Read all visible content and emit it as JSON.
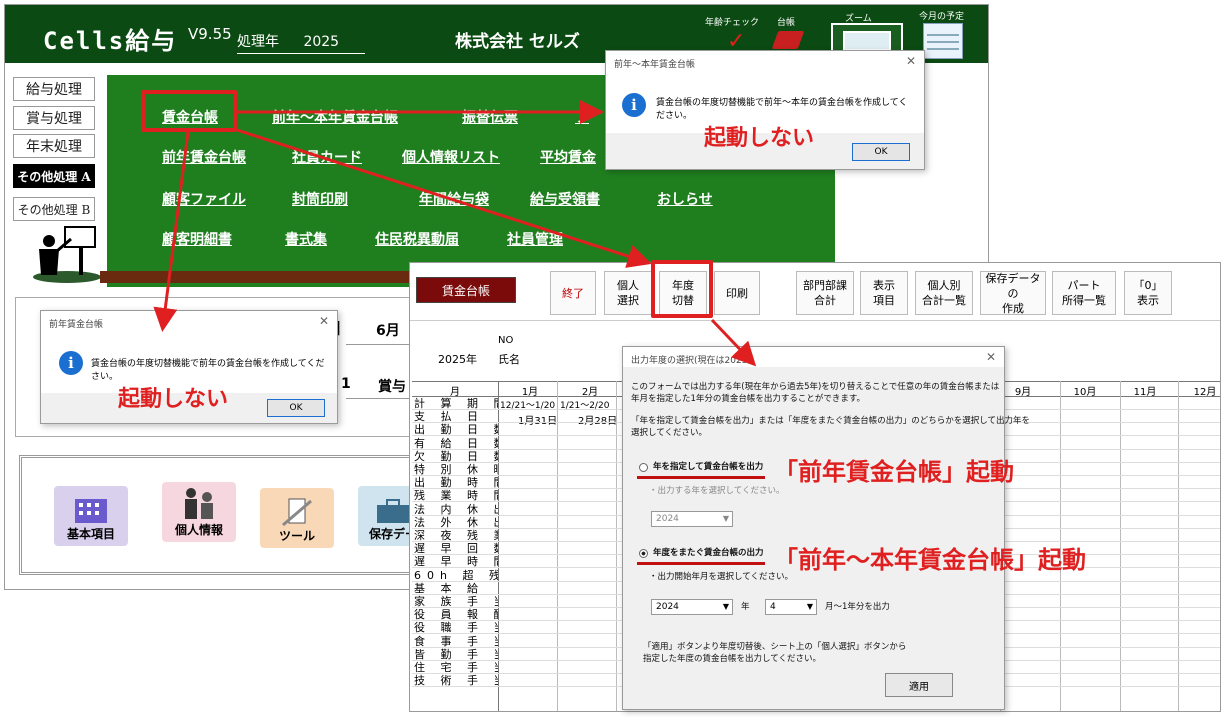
{
  "main_window": {
    "app_title": "Cells給与",
    "version": "V9.55",
    "year_label": "処理年",
    "year_value": "2025",
    "company": "株式会社 セルズ",
    "toolbar": {
      "age_check": "年齢チェック",
      "ledger": "台帳",
      "zoom": "ズーム",
      "schedule": "今月の予定"
    },
    "side_menu": [
      "給与処理",
      "賞与処理",
      "年末処理",
      "その他処理 A",
      "その他処理 B"
    ],
    "menu_links": {
      "wage_ledger": "賃金台帳",
      "prev_to_cur_ledger": "前年～本年賃金台帳",
      "transfer_slip": "振替伝票",
      "partial_f": "フ",
      "prev_ledger": "前年賃金台帳",
      "employee_card": "社員カード",
      "personal_list": "個人情報リスト",
      "avg_wage": "平均賃金",
      "customer_file": "顧客ファイル",
      "envelope_print": "封筒印刷",
      "annual_envelope": "年間給与袋",
      "receipt": "給与受領書",
      "notice": "おしらせ",
      "customer_detail": "顧客明細書",
      "forms": "書式集",
      "resident_tax": "住民税異動届",
      "data_mgmt": "社員管理"
    },
    "lower_table": {
      "head_june": "6月",
      "head_bonus": "賞与",
      "num": "1"
    },
    "tiles": [
      "基本項目",
      "個人情報",
      "ツール",
      "保存デー"
    ]
  },
  "dialog_top": {
    "title": "前年～本年賃金台帳",
    "message": "賃金台帳の年度切替機能で前年～本年の賃金台帳を作成してください。",
    "ok": "OK",
    "note": "起動しない"
  },
  "dialog_left": {
    "title": "前年賃金台帳",
    "message": "賃金台帳の年度切替機能で前年の賃金台帳を作成してください。",
    "ok": "OK",
    "note": "起動しない"
  },
  "sheet": {
    "title_btn": "賃金台帳",
    "buttons": {
      "end": "終了",
      "select_person": "個人\n選択",
      "year_switch": "年度\n切替",
      "print": "印刷",
      "dept_total": "部門部課\n合計",
      "display_items": "表示\n項目",
      "person_total": "個人別\n合計一覧",
      "saved_data": "保存データの\n作成",
      "part_income": "パート\n所得一覧",
      "zero_display": "「0」\n表示"
    },
    "no_label": "NO",
    "year_text": "2025年",
    "name_label": "氏名",
    "month_col": "月",
    "months": [
      "1月",
      "2月",
      "9月",
      "10月",
      "11月",
      "12月"
    ],
    "period_1": "12/21～1/20",
    "period_2": "1/21～2/20",
    "pay_1": "1月31日",
    "pay_2": "2月28日",
    "rows": [
      "計 算 期 間",
      "支 払 日",
      "出 勤 日 数",
      "有 給 日 数",
      "欠 勤 日 数",
      "特 別 休 暇",
      "出 勤 時 間",
      "残 業 時 間",
      "法 内 休 出",
      "法 外 休 出",
      "深 夜 残 業",
      "遅 早 回 数",
      "遅 早 時 間",
      "60h 超 残 業",
      "基 本 給",
      "家 族 手 当",
      "役 員 報 酬",
      "役 職 手 当",
      "食 事 手 当",
      "皆 勤 手 当",
      "住 宅 手 当",
      "技 術 手 当"
    ]
  },
  "year_dialog": {
    "title": "出力年度の選択(現在は2025",
    "desc_1": "このフォームでは出力する年(現在年から過去5年)を切り替えることで任意の年の賃金台帳または",
    "desc_2": "年月を指定した1年分の賃金台帳を出力することができます。",
    "desc_3": "「年を指定して賃金台帳を出力」または「年度をまたぐ賃金台帳の出力」のどちらかを選択して出力年を",
    "desc_4": "選択してください。",
    "option_1": "年を指定して賃金台帳を出力",
    "option_1_sub": "・出力する年を選択してください。",
    "option_1_year": "2024",
    "option_2": "年度をまたぐ賃金台帳の出力",
    "option_2_sub": "・出力開始年月を選択してください。",
    "start_year": "2024",
    "year_unit": "年",
    "start_month": "4",
    "month_suffix": "月～1年分を出力",
    "foot_1": "「適用」ボタンより年度切替後、シート上の「個人選択」ボタンから",
    "foot_2": "指定した年度の賃金台帳を出力してください。",
    "apply": "適用"
  },
  "annotations": {
    "prev_ledger_launch": "「前年賃金台帳」起動",
    "prev_to_cur_launch": "「前年～本年賃金台帳」起動"
  },
  "colors": {
    "title_green": "#0b4a12",
    "panel_green": "#1f7f1f",
    "highlight_red": "#e02020",
    "ledger_btn": "#7b0a0a"
  }
}
